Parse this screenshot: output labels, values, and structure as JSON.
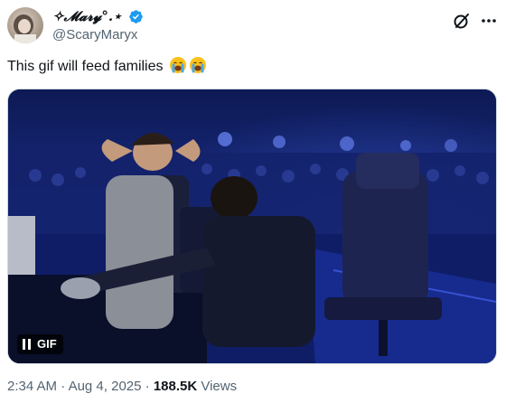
{
  "author": {
    "display_name": "✧𝓜𝓪𝓻𝔂°.⋆",
    "handle": "@ScaryMaryx",
    "verified": true
  },
  "tweet": {
    "text": "This gif will feed families",
    "emojis": [
      "loudly-crying-face-emoji",
      "loudly-crying-face-emoji"
    ]
  },
  "media": {
    "type": "gif",
    "badge_label": "GIF",
    "control_icon": "pause-icon"
  },
  "footer": {
    "time": "2:34 AM",
    "sep1": " · ",
    "date": "Aug 4, 2025",
    "sep2": " · ",
    "views_count": "188.5K",
    "views_label": " Views"
  },
  "icons": [
    "verified-badge-icon",
    "grok-icon",
    "more-options-icon"
  ],
  "colors": {
    "verified": "#1d9bf0",
    "secondary_text": "#536471",
    "text": "#0f1419"
  }
}
